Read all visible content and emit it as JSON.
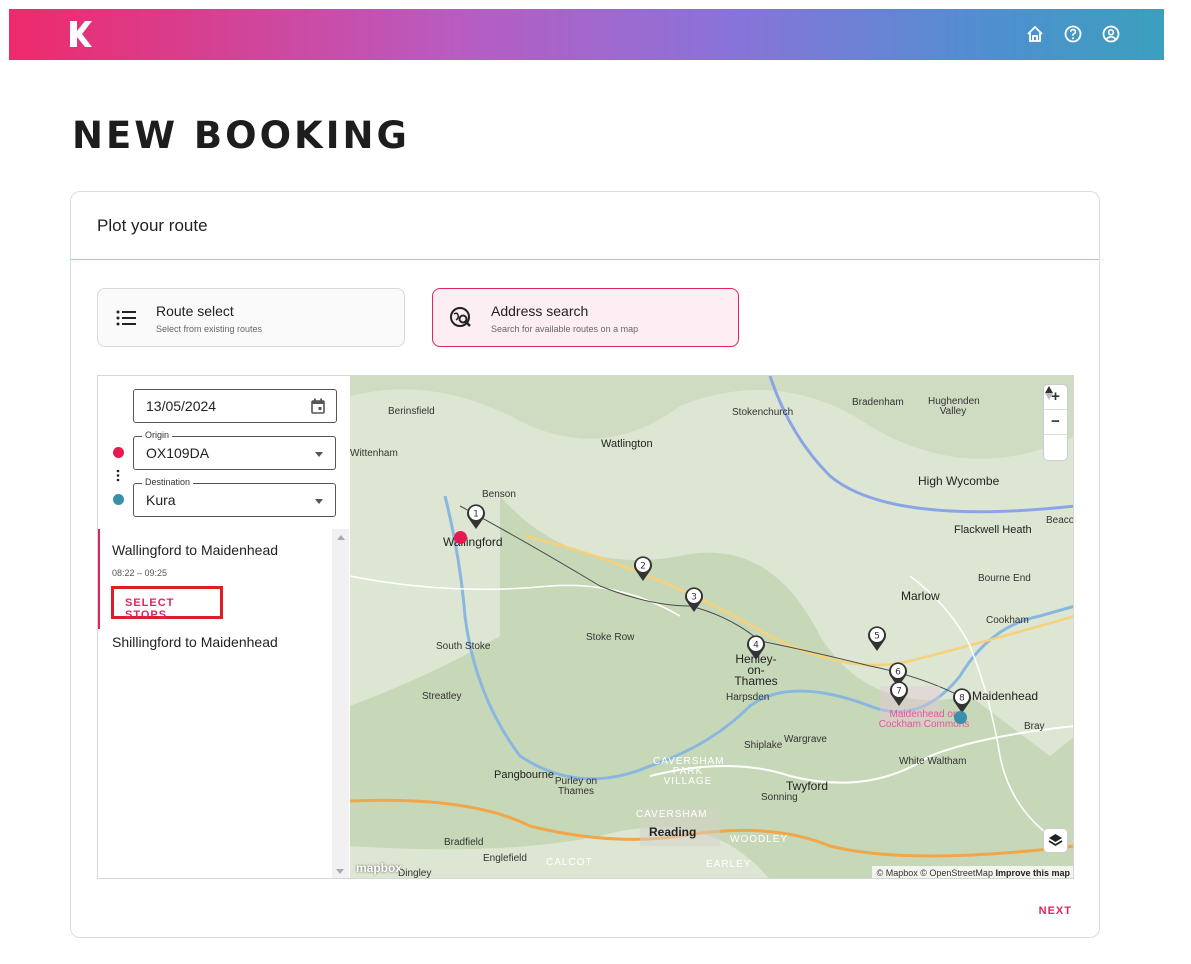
{
  "header": {
    "icons": [
      "logo-k",
      "home-icon",
      "help-icon",
      "account-icon"
    ]
  },
  "page": {
    "title": "NEW BOOKING"
  },
  "card": {
    "title": "Plot your route"
  },
  "modes": [
    {
      "title": "Route select",
      "subtitle": "Select from existing routes",
      "icon": "list-icon",
      "active": false
    },
    {
      "title": "Address search",
      "subtitle": "Search for available routes on a map",
      "icon": "map-search-icon",
      "active": true
    }
  ],
  "form": {
    "date": "13/05/2024",
    "origin_label": "Origin",
    "origin_value": "OX109DA",
    "destination_label": "Destination",
    "destination_value": "Kura"
  },
  "routes": [
    {
      "name": "Wallingford to Maidenhead",
      "time": "08:22 – 09:25",
      "action": "SELECT STOPS"
    },
    {
      "name": "Shillingford to Maidenhead"
    }
  ],
  "map": {
    "labels": [
      "Berinsfield",
      "Stokenchurch",
      "Bradenham",
      "Hughenden Valley",
      "Watlington",
      "Wittenham",
      "High Wycombe",
      "Benson",
      "Wallingford",
      "Flackwell Heath",
      "Beacon",
      "Bourne End",
      "Marlow",
      "Cookham",
      "South Stoke",
      "Stoke Row",
      "Henley-on-Thames",
      "Maidenhead",
      "Maidenhead on Cockham Commons",
      "Bray",
      "Streatley",
      "Harpsden",
      "Shiplake",
      "Wargrave",
      "White Waltham",
      "Pangbourne",
      "Purley on Thames",
      "CAVERSHAM PARK VILLAGE",
      "Sonning",
      "Twyford",
      "CAVERSHAM",
      "Reading",
      "WOODLEY",
      "Bradfield",
      "Englefield",
      "CALCOT",
      "EARLEY",
      "Dingley"
    ],
    "stops": [
      "1",
      "2",
      "3",
      "4",
      "5",
      "6",
      "7",
      "8"
    ],
    "attribution": "© Mapbox © OpenStreetMap",
    "improve": "Improve this map",
    "logo_text": "mapbox",
    "zoom_in": "+",
    "zoom_out": "−",
    "origin_color": "#e8194f",
    "destination_color": "#3a8fad"
  },
  "footer": {
    "next_label": "NEXT"
  }
}
